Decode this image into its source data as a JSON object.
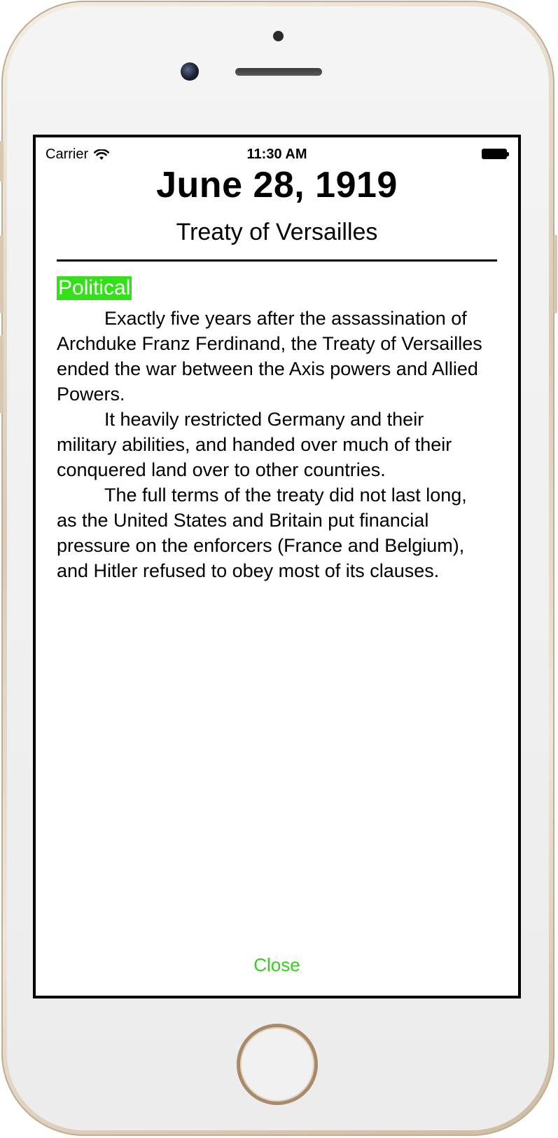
{
  "status_bar": {
    "carrier": "Carrier",
    "time": "11:30 AM",
    "wifi_icon": "wifi-icon",
    "battery_icon": "battery-icon"
  },
  "detail": {
    "date": "June 28, 1919",
    "event_title": "Treaty of Versailles",
    "category": "Political",
    "category_color": "#33e01a",
    "paragraphs": [
      "Exactly five years after the assassination of Archduke Franz Ferdinand, the Treaty of Versailles ended the war between the Axis powers and Allied Powers.",
      "It heavily restricted Germany and their military abilities, and handed over much of their conquered land over to other countries.",
      "The full terms of the treaty did not last long, as the United States and Britain put financial pressure on the enforcers (France and Belgium), and Hitler refused to obey most of its clauses."
    ]
  },
  "actions": {
    "close_label": "Close",
    "accent_color": "#33d11a"
  }
}
